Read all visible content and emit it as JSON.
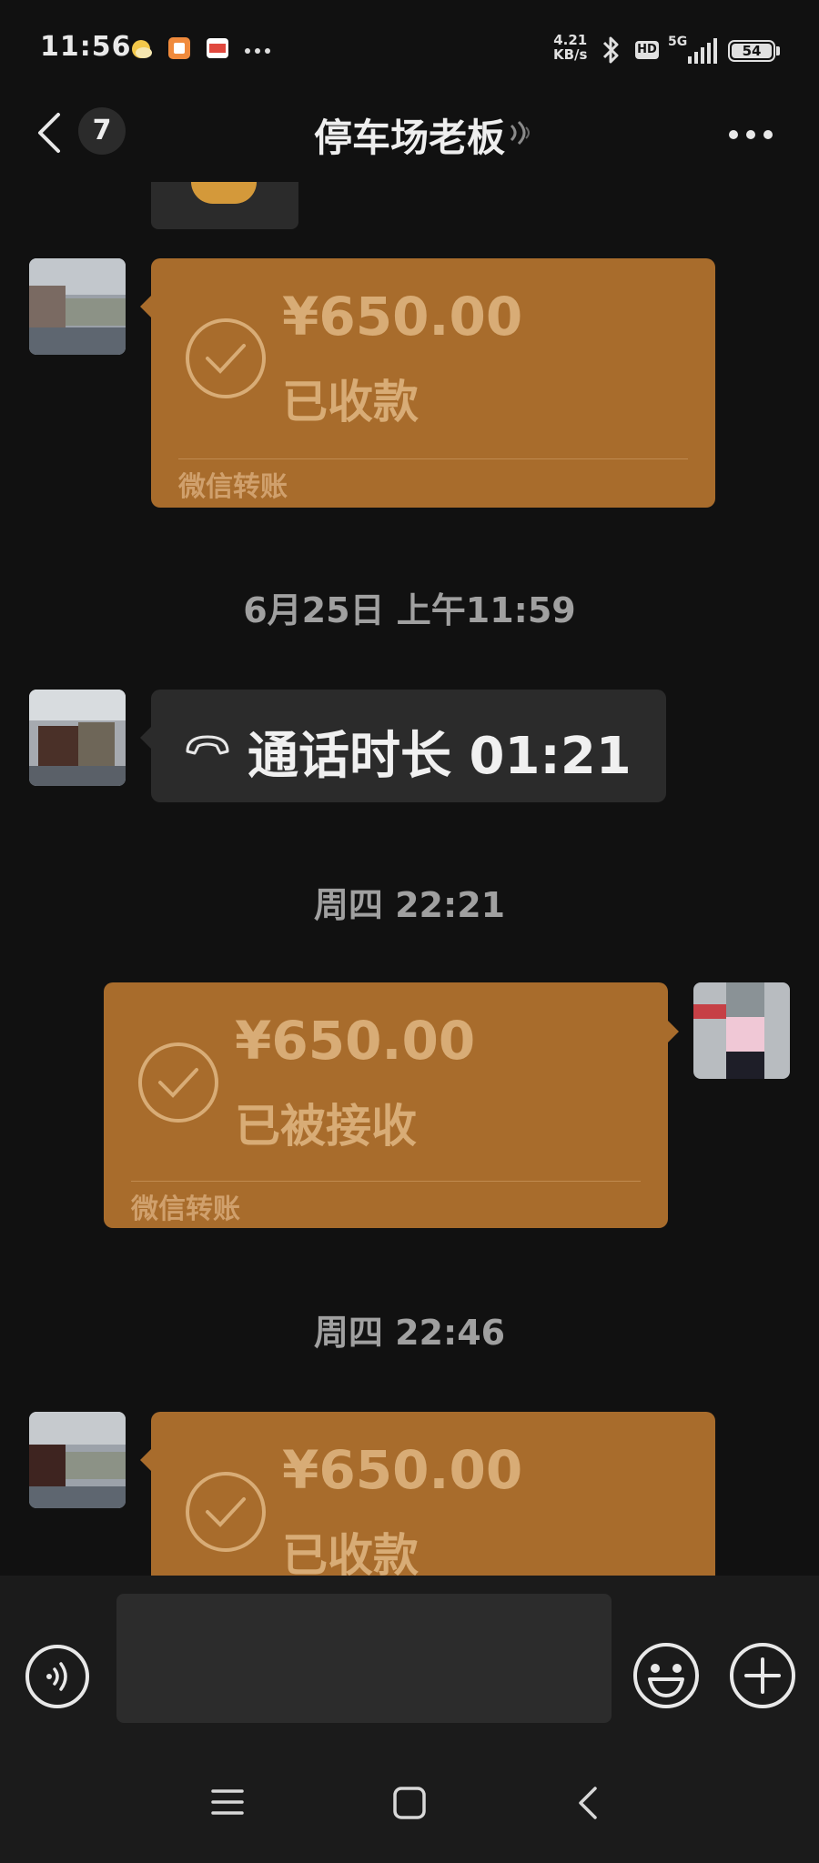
{
  "status_bar": {
    "time": "11:56",
    "net_speed_value": "4.21",
    "net_speed_unit": "KB/s",
    "hd": "HD",
    "network": "5G",
    "battery": "54"
  },
  "header": {
    "unread_count": "7",
    "title": "停车场老板"
  },
  "messages": {
    "transfer_1": {
      "amount": "¥650.00",
      "status": "已收款",
      "footer": "微信转账"
    },
    "timestamp_1": "6月25日 上午11:59",
    "call_1": {
      "text": "通话时长 01:21"
    },
    "timestamp_2": "周四 22:21",
    "transfer_2": {
      "amount": "¥650.00",
      "status": "已被接收",
      "footer": "微信转账"
    },
    "timestamp_3": "周四 22:46",
    "transfer_3": {
      "amount": "¥650.00",
      "status": "已收款"
    }
  },
  "icons": {
    "back": "chevron-left-icon",
    "mute": "voice-wave-icon",
    "more": "ellipsis-icon",
    "voice": "voice-input-icon",
    "emoji": "smiley-icon",
    "add": "plus-circle-icon",
    "check": "check-circle-icon",
    "call": "phone-hangup-icon"
  },
  "colors": {
    "background": "#111111",
    "transfer_bubble": "#a86c2c",
    "transfer_text": "#d8ac76",
    "call_bubble": "#2b2b2b",
    "timestamp_text": "#a0a0a0"
  }
}
